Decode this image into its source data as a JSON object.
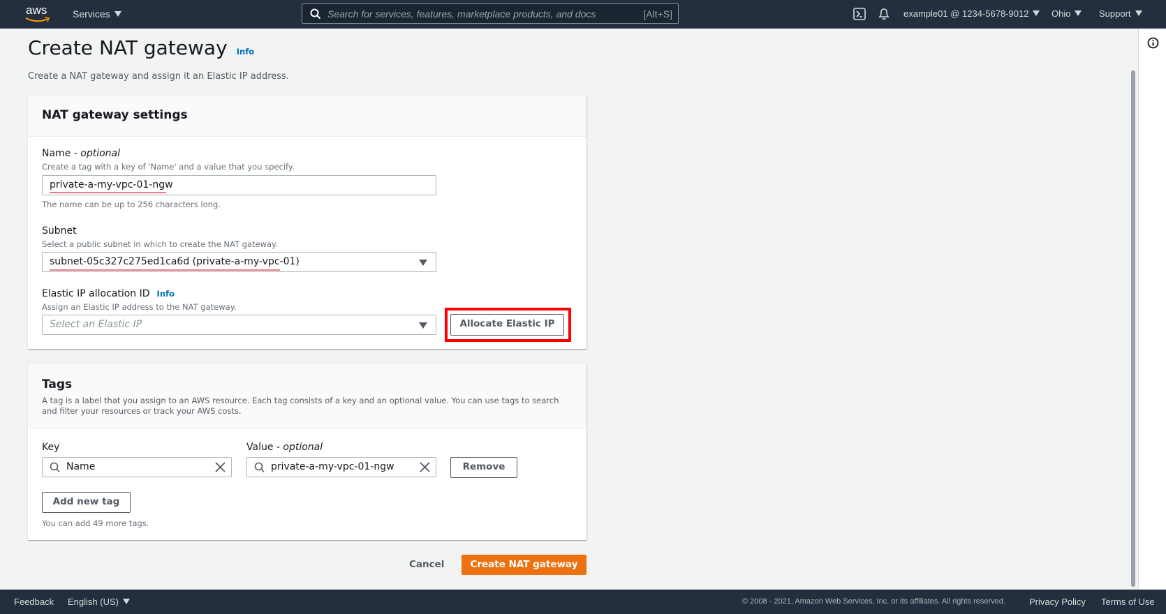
{
  "nav": {
    "logo": "aws",
    "services": "Services",
    "search_placeholder": "Search for services, features, marketplace products, and docs",
    "search_shortcut": "[Alt+S]",
    "account": "example01 @ 1234-5678-9012",
    "region": "Ohio",
    "support": "Support"
  },
  "page": {
    "title": "Create NAT gateway",
    "info": "Info",
    "subtitle": "Create a NAT gateway and assign it an Elastic IP address."
  },
  "settings": {
    "title": "NAT gateway settings",
    "name": {
      "label": "Name - ",
      "optional": "optional",
      "desc": "Create a tag with a key of 'Name' and a value that you specify.",
      "value": "private-a-my-vpc-01-ngw",
      "helper": "The name can be up to 256 characters long."
    },
    "subnet": {
      "label": "Subnet",
      "desc": "Select a public subnet in which to create the NAT gateway.",
      "value": "subnet-05c327c275ed1ca6d (private-a-my-vpc-01)"
    },
    "eip": {
      "label": "Elastic IP allocation ID",
      "info": "Info",
      "desc": "Assign an Elastic IP address to the NAT gateway.",
      "placeholder": "Select an Elastic IP",
      "allocate": "Allocate Elastic IP"
    }
  },
  "tags": {
    "title": "Tags",
    "desc": "A tag is a label that you assign to an AWS resource. Each tag consists of a key and an optional value. You can use tags to search and filter your resources or track your AWS costs.",
    "key_label": "Key",
    "value_label": "Value - ",
    "value_optional": "optional",
    "key_value": "Name",
    "value_value": "private-a-my-vpc-01-ngw",
    "remove": "Remove",
    "add": "Add new tag",
    "helper": "You can add 49 more tags."
  },
  "actions": {
    "cancel": "Cancel",
    "create": "Create NAT gateway"
  },
  "footer": {
    "feedback": "Feedback",
    "language": "English (US)",
    "copyright": "© 2008 - 2021, Amazon Web Services, Inc. or its affiliates. All rights reserved.",
    "privacy": "Privacy Policy",
    "terms": "Terms of Use"
  },
  "colors": {
    "nav": "#232f3e",
    "primary": "#ec7211",
    "highlight": "#ff0000",
    "link": "#0073bb"
  }
}
